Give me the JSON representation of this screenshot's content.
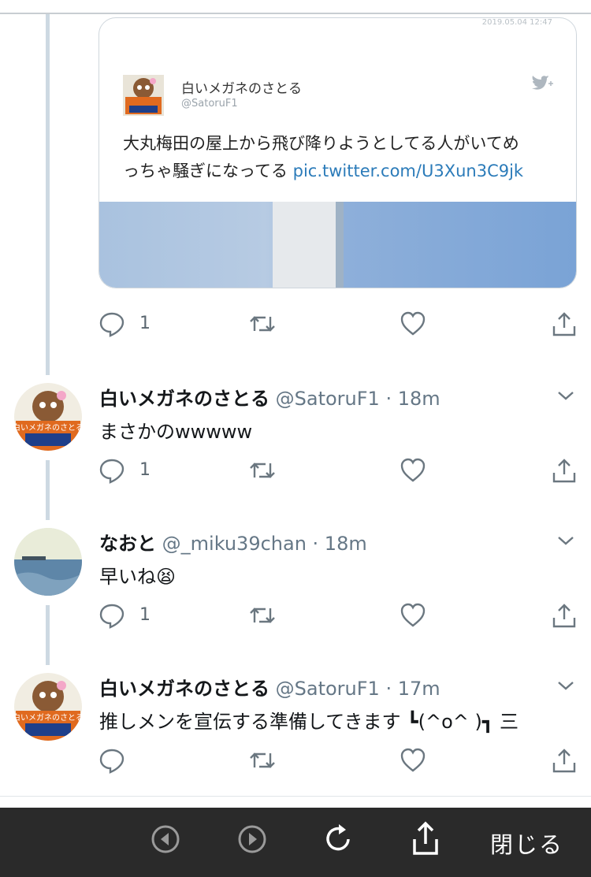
{
  "card": {
    "timestamp": "2019.05.04 12:47",
    "name": "白いメガネのさとる",
    "handle": "@SatoruF1",
    "text_line1": "大丸梅田の屋上から飛び降りようとしてる人がいてめ",
    "text_line2": "っちゃ騒ぎになってる",
    "link": "pic.twitter.com/U3Xun3C9jk"
  },
  "tweets": [
    {
      "name": "白いメガネのさとる",
      "meta": "@SatoruF1 · 18m",
      "text": "まさかのwwwww",
      "reply_count": "1",
      "avatar": "monkey-avatar"
    },
    {
      "name": "なおと",
      "meta": "@_miku39chan · 18m",
      "text": "早いね😫",
      "reply_count": "1",
      "avatar": "sea-avatar"
    },
    {
      "name": "白いメガネのさとる",
      "meta": "@SatoruF1 · 17m",
      "text": "推しメンを宣伝する準備してきます ┗(^o^ )┓ 三",
      "reply_count": "",
      "avatar": "monkey-avatar"
    }
  ],
  "card_actions": {
    "reply_count": "1"
  },
  "avatar_text": "白いメガネのさとる",
  "toolbar": {
    "close_label": "閉じる"
  },
  "colors": {
    "link": "#2b7bb9",
    "thread_line": "#cdd9e2",
    "toolbar_bg": "#2a2a2a",
    "meta": "#657786"
  }
}
